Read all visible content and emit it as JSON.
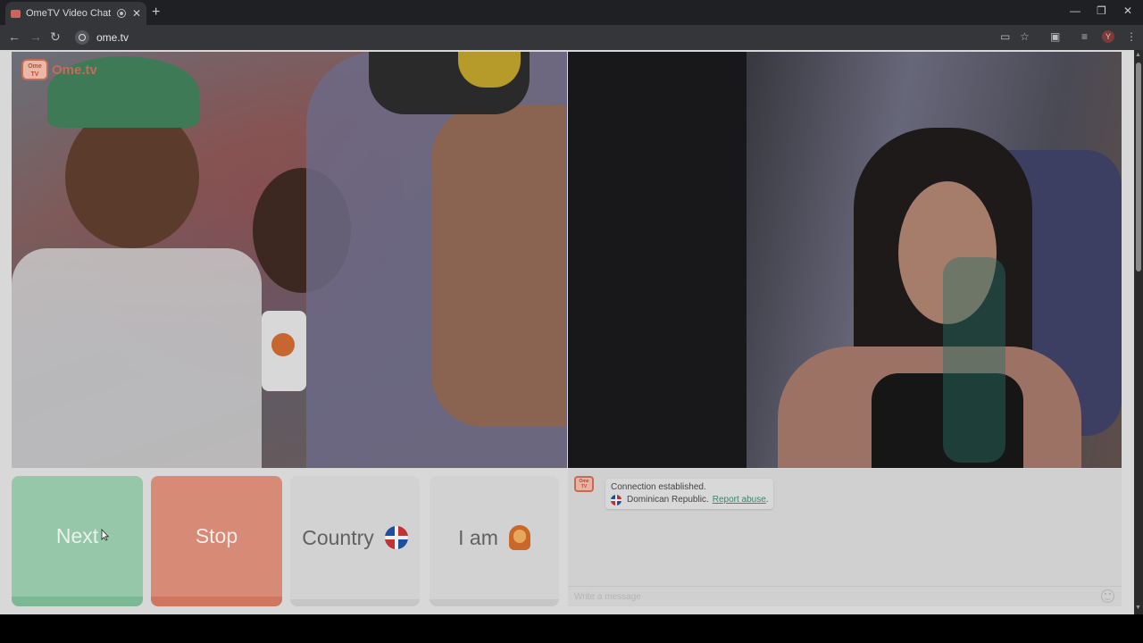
{
  "browser": {
    "tab_title": "OmeTV Video Chat — Ome",
    "tab_close": "✕",
    "new_tab": "+",
    "minimize": "—",
    "restore": "❐",
    "close": "✕",
    "url": "ome.tv",
    "profile_initial": "Y"
  },
  "logo": {
    "badge_line1": "Ome",
    "badge_line2": "TV",
    "brand": "Ome.tv"
  },
  "buttons": {
    "next": "Next",
    "stop": "Stop",
    "country": "Country",
    "i_am": "I am"
  },
  "chat": {
    "badge_line1": "Ome",
    "badge_line2": "TV",
    "status": "Connection established.",
    "country": "Dominican Republic.",
    "report_link": "Report abuse",
    "report_suffix": ".",
    "input_placeholder": "Write a message"
  },
  "icons": {
    "country_flag": "dominican-republic-flag-icon",
    "gender": "woman-emoji-icon",
    "emoji": "smiley-icon"
  }
}
